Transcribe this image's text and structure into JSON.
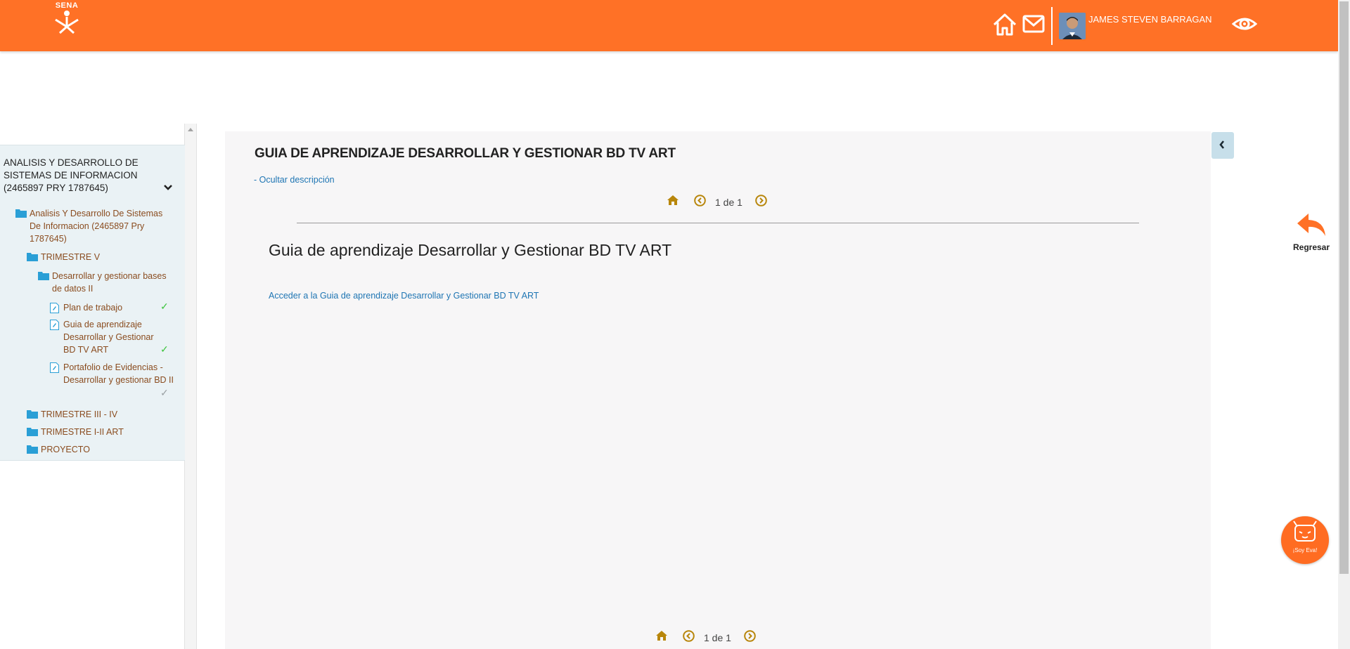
{
  "header": {
    "logo_text": "SENA",
    "user_name": "JAMES STEVEN BARRAGAN",
    "accent_color": "#ff7126"
  },
  "sidebar": {
    "course_title": "ANALISIS Y DESARROLLO DE SISTEMAS DE INFORMACION (2465897 PRY 1787645)",
    "items": [
      {
        "label": "Analisis Y Desarrollo De Sistemas De Informacion (2465897 Pry 1787645)",
        "icon": "folder-icon"
      },
      {
        "label": "TRIMESTRE V",
        "icon": "folder-icon"
      },
      {
        "label": "Desarrollar y gestionar bases de datos II",
        "icon": "folder-icon"
      },
      {
        "label": "Plan de trabajo",
        "icon": "document-icon",
        "check": "✓"
      },
      {
        "label": "Guia de aprendizaje Desarrollar y Gestionar BD TV ART",
        "icon": "document-icon",
        "check": "✓"
      },
      {
        "label": "Portafolio de Evidencias - Desarrollar y gestionar BD II",
        "icon": "document-icon",
        "check": "✓"
      },
      {
        "label": "TRIMESTRE III - IV",
        "icon": "folder-icon"
      },
      {
        "label": "TRIMESTRE I-II ART",
        "icon": "folder-icon"
      },
      {
        "label": "PROYECTO",
        "icon": "folder-icon"
      }
    ]
  },
  "main": {
    "title": "GUIA DE APRENDIZAJE DESARROLLAR Y GESTIONAR BD TV ART",
    "hide_description": "- Ocultar descripción",
    "pager_text": "1 de 1",
    "content_title": "Guia de aprendizaje Desarrollar y Gestionar BD TV ART",
    "content_link": "Acceder a la Guia de aprendizaje Desarrollar y Gestionar BD TV ART",
    "bottom_pager_text": "1 de 1"
  },
  "side_actions": {
    "back_label": "Regresar",
    "assistant_label": "¡Soy Eva!"
  }
}
